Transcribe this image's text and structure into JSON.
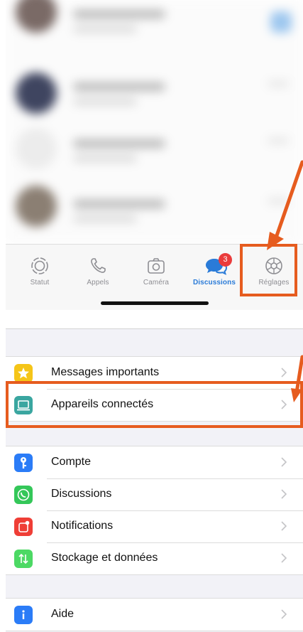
{
  "colors": {
    "accent": "#2a7bd8",
    "badge": "#ea3b3b",
    "highlight": "#e65c1f",
    "separator": "#dcdcdc",
    "group_background": "#f2f2f7"
  },
  "chat_list": {
    "blurred": true,
    "rows": [
      {
        "avatar_color": "#7a6a66"
      },
      {
        "avatar_color": "#3f4560"
      },
      {
        "avatar_color": "#e6e6e6"
      },
      {
        "avatar_color": "#8b7f73"
      }
    ]
  },
  "tab_bar": {
    "tabs": [
      {
        "label": "Statut",
        "icon": "status-icon",
        "active": false
      },
      {
        "label": "Appels",
        "icon": "phone-icon",
        "active": false
      },
      {
        "label": "Caméra",
        "icon": "camera-icon",
        "active": false
      },
      {
        "label": "Discussions",
        "icon": "chat-bubbles-icon",
        "active": true,
        "badge": "3"
      },
      {
        "label": "Réglages",
        "icon": "gear-icon",
        "active": false
      }
    ]
  },
  "settings": {
    "groups": [
      {
        "rows": [
          {
            "label": "Messages importants",
            "icon": "star-icon",
            "icon_color": "#f5c518"
          },
          {
            "label": "Appareils connectés",
            "icon": "laptop-icon",
            "icon_color": "#3aa6a0"
          }
        ]
      },
      {
        "rows": [
          {
            "label": "Compte",
            "icon": "key-icon",
            "icon_color": "#2b7cf7"
          },
          {
            "label": "Discussions",
            "icon": "whatsapp-icon",
            "icon_color": "#34c759"
          },
          {
            "label": "Notifications",
            "icon": "notification-icon",
            "icon_color": "#ef3e36"
          },
          {
            "label": "Stockage et données",
            "icon": "storage-arrows-icon",
            "icon_color": "#4cd964"
          }
        ]
      },
      {
        "rows": [
          {
            "label": "Aide",
            "icon": "info-icon",
            "icon_color": "#2b7cf7"
          }
        ]
      }
    ]
  }
}
